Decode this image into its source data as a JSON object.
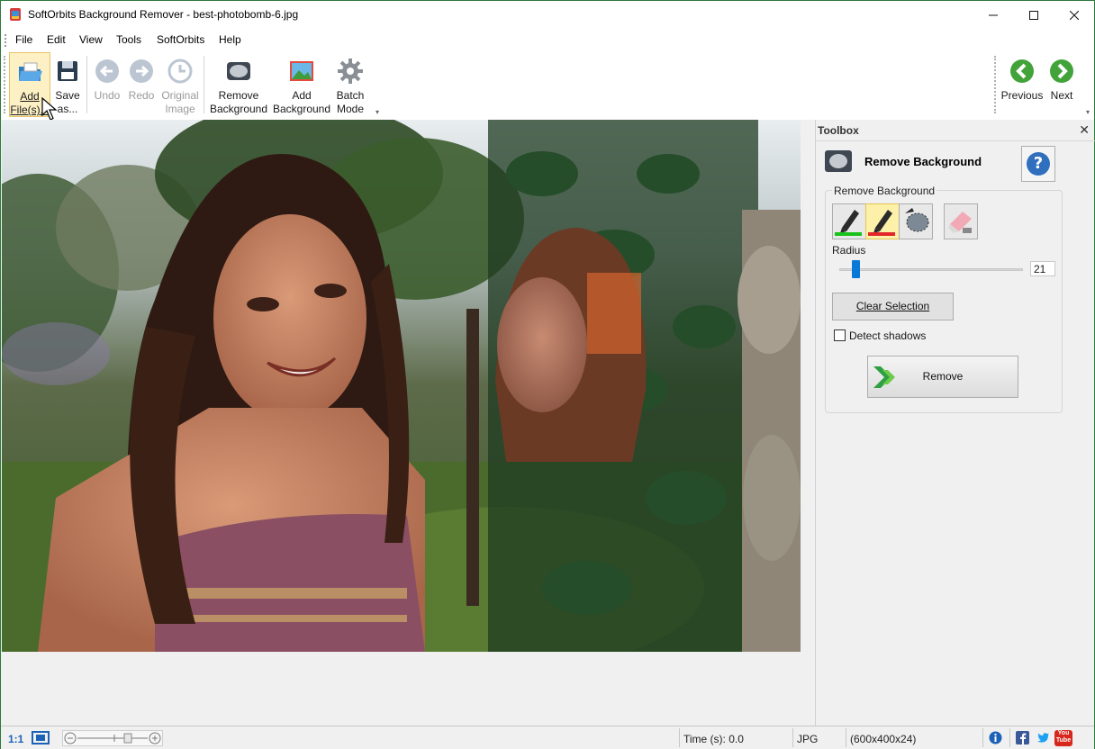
{
  "window": {
    "title": "SoftOrbits Background Remover - best-photobomb-6.jpg",
    "controls": {
      "minimize": "—",
      "maximize": "☐",
      "close": "✕"
    }
  },
  "menu": {
    "items": [
      "File",
      "Edit",
      "View",
      "Tools",
      "SoftOrbits",
      "Help"
    ]
  },
  "toolbar": {
    "add_files": {
      "line1": "Add",
      "line2": "File(s)..."
    },
    "save_as": {
      "line1": "Save",
      "line2": "as..."
    },
    "undo": "Undo",
    "redo": "Redo",
    "original_image": {
      "line1": "Original",
      "line2": "Image"
    },
    "remove_background": {
      "line1": "Remove",
      "line2": "Background"
    },
    "add_background": {
      "line1": "Add",
      "line2": "Background"
    },
    "batch_mode": {
      "line1": "Batch",
      "line2": "Mode"
    },
    "previous": "Previous",
    "next": "Next"
  },
  "toolbox": {
    "title": "Toolbox",
    "close": "✕",
    "section_title": "Remove Background",
    "help": "?",
    "group_label": "Remove Background",
    "radius_label": "Radius",
    "radius_value": "21",
    "radius_level": 0.07,
    "clear_selection": "Clear Selection",
    "detect_shadows": "Detect shadows",
    "detect_shadows_checked": false,
    "remove": "Remove"
  },
  "statusbar": {
    "zoom_1to1": "1:1",
    "time": "Time (s): 0.0",
    "format": "JPG",
    "dimensions": "(600x400x24)",
    "social_youtube": "You Tube"
  },
  "colors": {
    "accent_green": "#2b7a3b",
    "nav_green": "#43a33b",
    "active_highlight": "#fdf0c4",
    "slider_blue": "#0a78d7",
    "help_blue": "#2f6fbe"
  }
}
